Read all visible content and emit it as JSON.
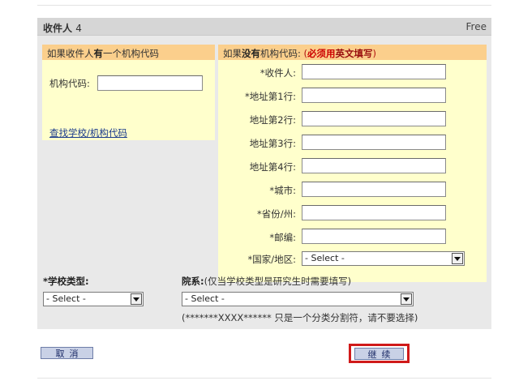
{
  "header": {
    "title": "收件人",
    "number": "4",
    "badge": "Free"
  },
  "left_section": {
    "heading_pre": "如果收件人",
    "heading_bold": "有",
    "heading_post": "一个机构代码",
    "code_label": "机构代码:",
    "code_value": "",
    "find_link": "查找学校/机构代码"
  },
  "right_section": {
    "heading_pre": "如果",
    "heading_bold": "没有",
    "heading_post": "机构代码:",
    "heading_note_open": "(",
    "heading_note_red": "必须用",
    "heading_note_bold": "英文填写",
    "heading_note_close": ")",
    "fields": [
      {
        "label": "*收件人:",
        "value": ""
      },
      {
        "label": "*地址第1行:",
        "value": ""
      },
      {
        "label": "地址第2行:",
        "value": ""
      },
      {
        "label": "地址第3行:",
        "value": ""
      },
      {
        "label": "地址第4行:",
        "value": ""
      },
      {
        "label": "*城市:",
        "value": ""
      },
      {
        "label": "*省份/州:",
        "value": ""
      },
      {
        "label": "*邮编:",
        "value": ""
      }
    ],
    "country_label": "*国家/地区:",
    "country_selected": "- Select -"
  },
  "bottom": {
    "school_type_label": "*学校类型:",
    "school_type_selected": "- Select -",
    "dept_label_bold": "院系:",
    "dept_label_note": "(仅当学校类型是研究生时需要填写)",
    "dept_selected": "- Select -",
    "separator_note": "(*******XXXX****** 只是一个分类分割符，请不要选择)"
  },
  "buttons": {
    "cancel": "取消",
    "continue": "继续"
  },
  "colors": {
    "panel_bg": "#e9e9e9",
    "header_bg": "#d6d6d6",
    "section_bg": "#ffffcc",
    "section_head_bg": "#fbcf8c",
    "highlight": "#d01a1a",
    "button_bg": "#c9d1e6"
  }
}
